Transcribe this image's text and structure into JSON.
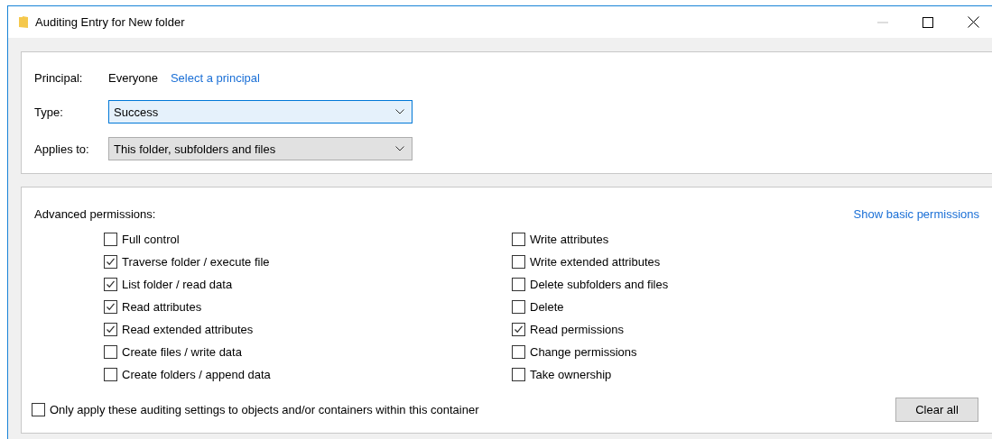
{
  "window": {
    "title": "Auditing Entry for New folder"
  },
  "principal": {
    "label": "Principal:",
    "value": "Everyone",
    "link": "Select a principal"
  },
  "fields": [
    {
      "label": "Type:",
      "value": "Success",
      "focused": true
    },
    {
      "label": "Applies to:",
      "value": "This folder, subfolders and files",
      "focused": false
    }
  ],
  "permissions": {
    "label": "Advanced permissions:",
    "link": "Show basic permissions",
    "columns": [
      [
        {
          "label": "Full control",
          "checked": false
        },
        {
          "label": "Traverse folder / execute file",
          "checked": true
        },
        {
          "label": "List folder / read data",
          "checked": true
        },
        {
          "label": "Read attributes",
          "checked": true
        },
        {
          "label": "Read extended attributes",
          "checked": true
        },
        {
          "label": "Create files / write data",
          "checked": false
        },
        {
          "label": "Create folders / append data",
          "checked": false
        }
      ],
      [
        {
          "label": "Write attributes",
          "checked": false
        },
        {
          "label": "Write extended attributes",
          "checked": false
        },
        {
          "label": "Delete subfolders and files",
          "checked": false
        },
        {
          "label": "Delete",
          "checked": false
        },
        {
          "label": "Read permissions",
          "checked": true
        },
        {
          "label": "Change permissions",
          "checked": false
        },
        {
          "label": "Take ownership",
          "checked": false
        }
      ]
    ]
  },
  "only_apply": {
    "label": "Only apply these auditing settings to objects and/or containers within this container",
    "checked": false
  },
  "clear_button": "Clear all"
}
